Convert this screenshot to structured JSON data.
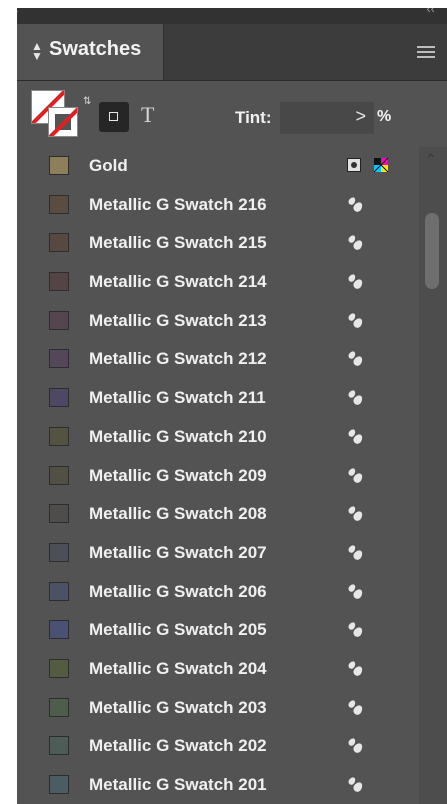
{
  "window": {
    "close_glyph": "×",
    "collapse_glyph": "‹‹"
  },
  "panel": {
    "title": "Swatches",
    "tint_label": "Tint:",
    "tint_value": "",
    "tint_unit": "%",
    "formatting_text_glyph": "T"
  },
  "swatches": [
    {
      "name": "Gold",
      "color": "#8d7f59",
      "type": "spot"
    },
    {
      "name": "Metallic G Swatch 216",
      "color": "#5a4c40",
      "type": "metallic"
    },
    {
      "name": "Metallic G Swatch 215",
      "color": "#574842",
      "type": "metallic"
    },
    {
      "name": "Metallic G Swatch 214",
      "color": "#544446",
      "type": "metallic"
    },
    {
      "name": "Metallic G Swatch 213",
      "color": "#54454f",
      "type": "metallic"
    },
    {
      "name": "Metallic G Swatch 212",
      "color": "#534759",
      "type": "metallic"
    },
    {
      "name": "Metallic G Swatch 211",
      "color": "#4f4864",
      "type": "metallic"
    },
    {
      "name": "Metallic G Swatch 210",
      "color": "#545241",
      "type": "metallic"
    },
    {
      "name": "Metallic G Swatch 209",
      "color": "#525044",
      "type": "metallic"
    },
    {
      "name": "Metallic G Swatch 208",
      "color": "#4e4d4b",
      "type": "metallic"
    },
    {
      "name": "Metallic G Swatch 207",
      "color": "#4d4f57",
      "type": "metallic"
    },
    {
      "name": "Metallic G Swatch 206",
      "color": "#4c5263",
      "type": "metallic"
    },
    {
      "name": "Metallic G Swatch 205",
      "color": "#4a5172",
      "type": "metallic"
    },
    {
      "name": "Metallic G Swatch 204",
      "color": "#535c43",
      "type": "metallic"
    },
    {
      "name": "Metallic G Swatch 203",
      "color": "#4f5d4c",
      "type": "metallic"
    },
    {
      "name": "Metallic G Swatch 202",
      "color": "#4d5c57",
      "type": "metallic"
    },
    {
      "name": "Metallic G Swatch 201",
      "color": "#4b5c62",
      "type": "metallic"
    }
  ]
}
